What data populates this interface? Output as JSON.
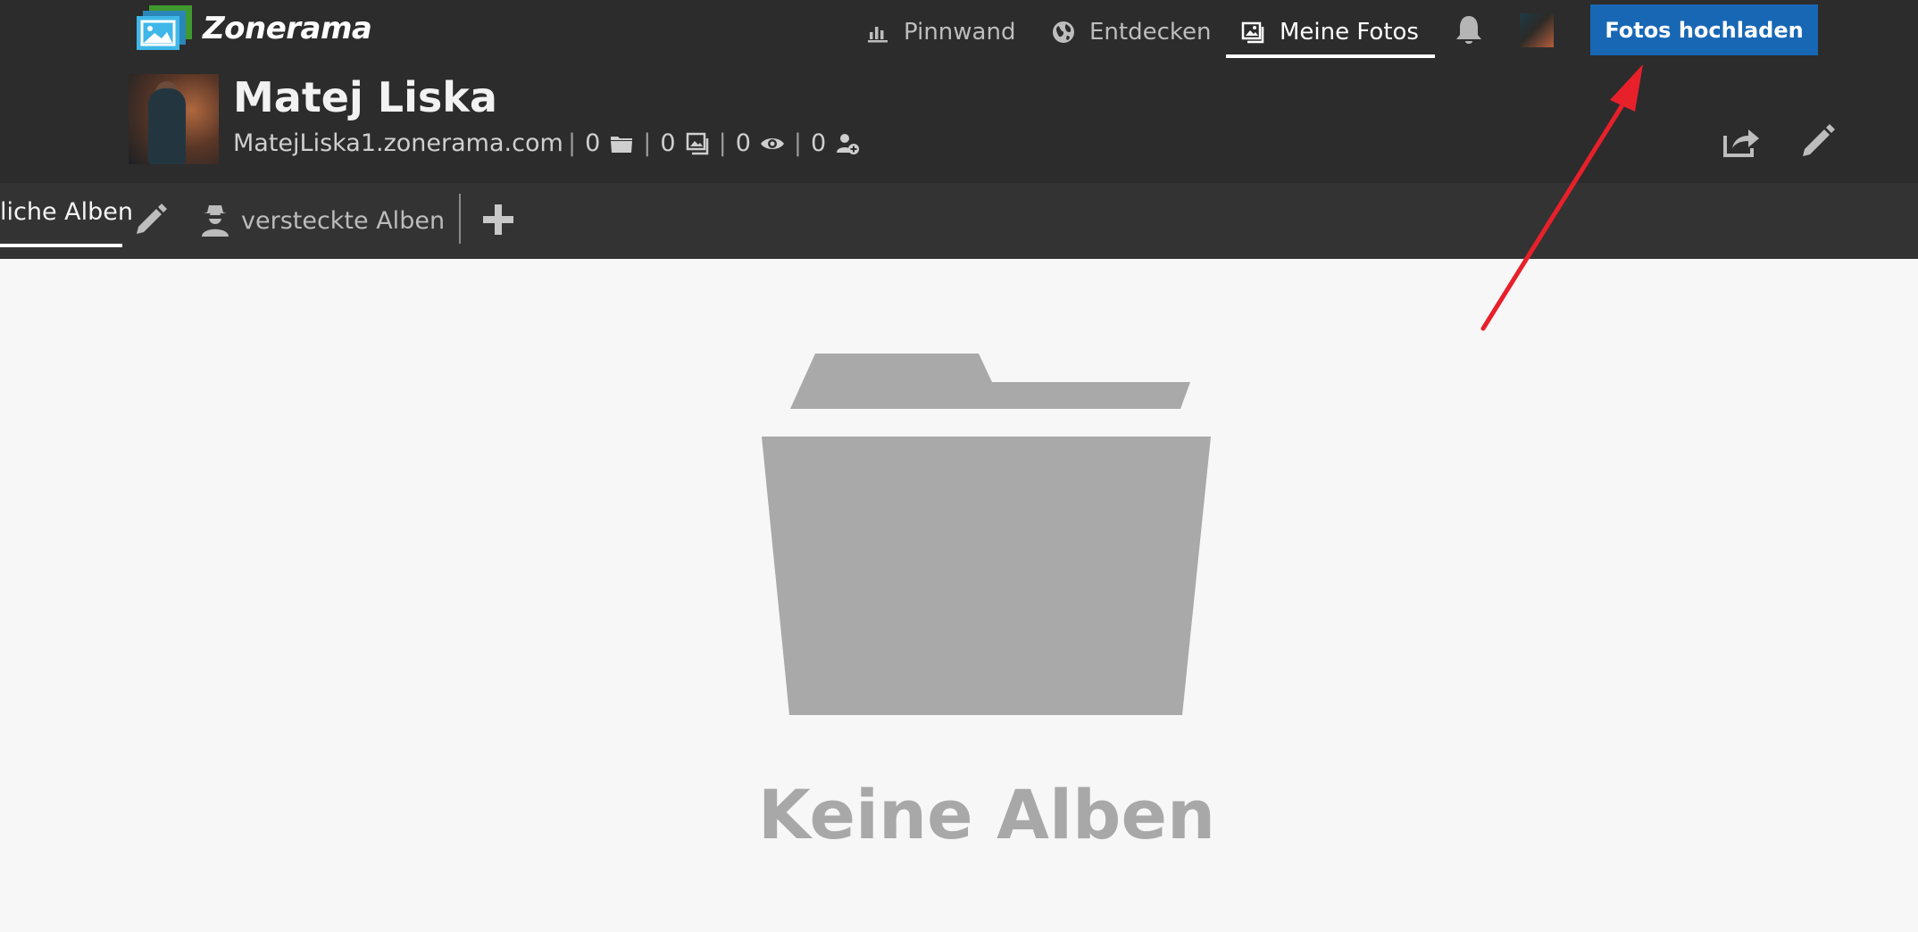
{
  "app": {
    "brand": "Zonerama",
    "logo_icon": "zonerama-logo"
  },
  "nav": {
    "items": [
      {
        "label": "Pinnwand",
        "icon": "bar-chart-icon",
        "active": false
      },
      {
        "label": "Entdecken",
        "icon": "globe-icon",
        "active": false
      },
      {
        "label": "Meine Fotos",
        "icon": "photos-icon",
        "active": true
      }
    ],
    "notifications_icon": "bell-icon",
    "upload_button": "Fotos hochladen"
  },
  "profile": {
    "name": "Matej Liska",
    "url": "MatejLiska1.zonerama.com",
    "stats": {
      "separator": "|",
      "albums": "0",
      "photos": "0",
      "views": "0",
      "followers": "0"
    }
  },
  "tabs": {
    "public_albums": "liche Alben",
    "hidden_albums": "versteckte Alben"
  },
  "empty_state": {
    "icon": "folder-icon",
    "text": "Keine Alben"
  },
  "colors": {
    "header_bg": "#2c2c2c",
    "tabbar_bg": "#333333",
    "accent": "#1867b5",
    "annotation_arrow": "#e8202a",
    "empty_gray": "#a8a8a8"
  }
}
